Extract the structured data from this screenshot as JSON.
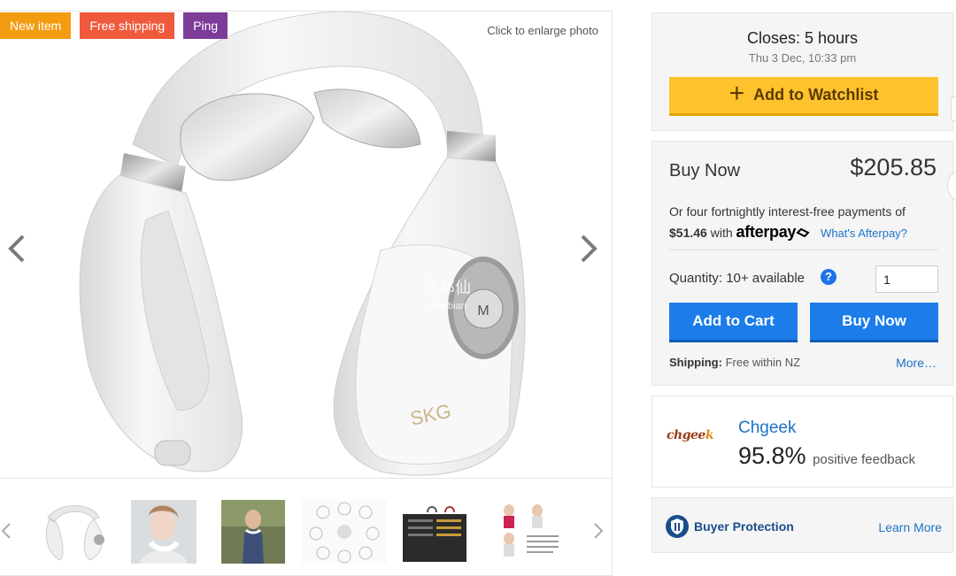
{
  "badges": [
    {
      "label": "New item",
      "color": "#f39c12"
    },
    {
      "label": "Free shipping",
      "color": "#f05a3c"
    },
    {
      "label": "Ping",
      "color": "#7d3c98"
    }
  ],
  "gallery": {
    "enlarge_label": "Click to enlarge photo",
    "product_brand": "SKG",
    "watermark": "海邦仙",
    "watermark_sub": "Hinabian",
    "button_letter": "M"
  },
  "listing": {
    "closes_label": "Closes: 5 hours",
    "closes_date": "Thu 3 Dec, 10:33 pm",
    "watchlist_label": "Add to Watchlist"
  },
  "buy": {
    "label": "Buy Now",
    "price": "$205.85",
    "afterpay_intro": "Or four fortnightly interest-free payments of",
    "afterpay_amount": "$51.46",
    "afterpay_with": "with",
    "afterpay_brand": "afterpay",
    "afterpay_link": "What's Afterpay?",
    "quantity_label": "Quantity: 10+ available",
    "quantity_value": "1",
    "add_to_cart": "Add to Cart",
    "buy_now": "Buy Now",
    "shipping_label": "Shipping:",
    "shipping_value": "Free within NZ",
    "more_link": "More…"
  },
  "seller": {
    "logo_text": "chgee",
    "logo_k": "k",
    "name": "Chgeek",
    "feedback_pct": "95.8%",
    "feedback_label": "positive feedback"
  },
  "protection": {
    "label": "Buyer Protection",
    "link": "Learn More"
  },
  "colors": {
    "accent_blue": "#1c7cea",
    "watchlist_yellow": "#fec22d",
    "link_blue": "#1c73c9"
  }
}
